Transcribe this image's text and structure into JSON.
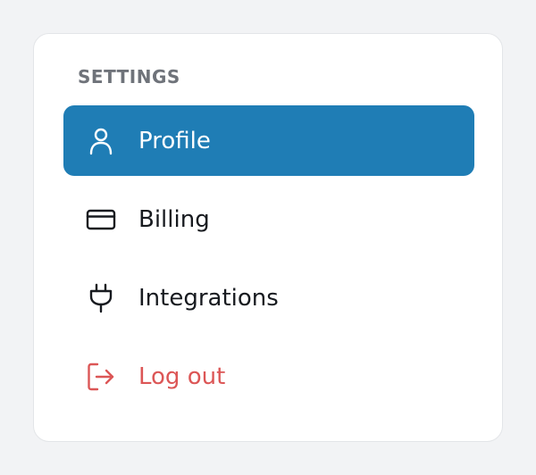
{
  "settings_menu": {
    "title": "SETTINGS",
    "items": [
      {
        "label": "Profile",
        "icon": "user-icon",
        "state": "selected"
      },
      {
        "label": "Billing",
        "icon": "credit-card-icon"
      },
      {
        "label": "Integrations",
        "icon": "plug-icon"
      },
      {
        "label": "Log out",
        "icon": "logout-icon"
      }
    ]
  },
  "colors": {
    "page_background": "#f2f3f5",
    "card_background": "#ffffff",
    "active_background": "#1f7db5",
    "active_text": "#ffffff",
    "default_text": "#171a1f",
    "section_title": "#6f737a",
    "danger": "#dc5656"
  }
}
